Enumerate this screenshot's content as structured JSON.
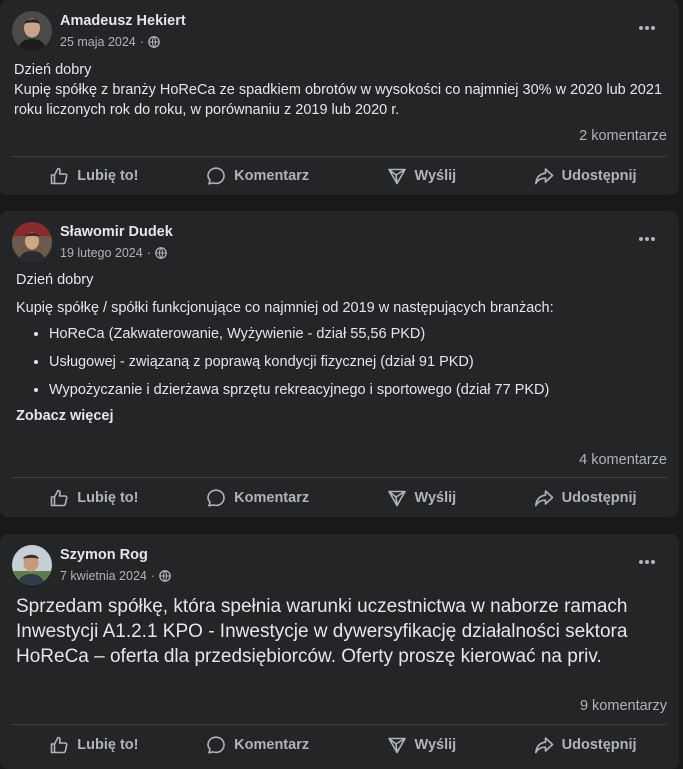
{
  "actions": {
    "like": "Lubię to!",
    "comment": "Komentarz",
    "send": "Wyślij",
    "share": "Udostępnij"
  },
  "posts": [
    {
      "author": "Amadeusz Hekiert",
      "date": "25 maja 2024",
      "separator": "·",
      "greeting": "Dzień dobry",
      "text": "Kupię spółkę z branży HoReCa ze spadkiem obrotów w wysokości co najmniej 30% w 2020 lub 2021 roku liczonych rok do roku, w porównaniu z 2019 lub 2020 r.",
      "comments": "2 komentarze"
    },
    {
      "author": "Sławomir Dudek",
      "date": "19 lutego 2024",
      "separator": "·",
      "greeting": "Dzień dobry",
      "text": "Kupię spółkę / spółki funkcjonujące co najmniej od 2019 w następujących branżach:",
      "items": [
        "HoReCa (Zakwaterowanie, Wyżywienie - dział 55,56 PKD)",
        "Usługowej - związaną z poprawą kondycji fizycznej (dział 91 PKD)",
        "Wypożyczanie i dzierżawa sprzętu rekreacyjnego i sportowego (dział 77 PKD)"
      ],
      "see_more": "Zobacz więcej",
      "comments": "4 komentarze"
    },
    {
      "author": "Szymon Rog",
      "date": "7 kwietnia 2024",
      "separator": "·",
      "text": "Sprzedam spółkę, która spełnia warunki uczestnictwa w naborze ramach Inwestycji A1.2.1 KPO - Inwestycje w dywersyfikację działalności sektora HoReCa – oferta dla przedsiębiorców. Oferty proszę kierować na priv.",
      "comments": "9 komentarzy"
    }
  ],
  "colors": {
    "page_bg": "#18191a",
    "card_bg": "#242526",
    "primary_text": "#e4e6eb",
    "secondary_text": "#b0b3b8"
  },
  "icons": [
    "globe-icon",
    "more-options-icon",
    "like-icon",
    "comment-icon",
    "send-icon",
    "share-icon"
  ]
}
